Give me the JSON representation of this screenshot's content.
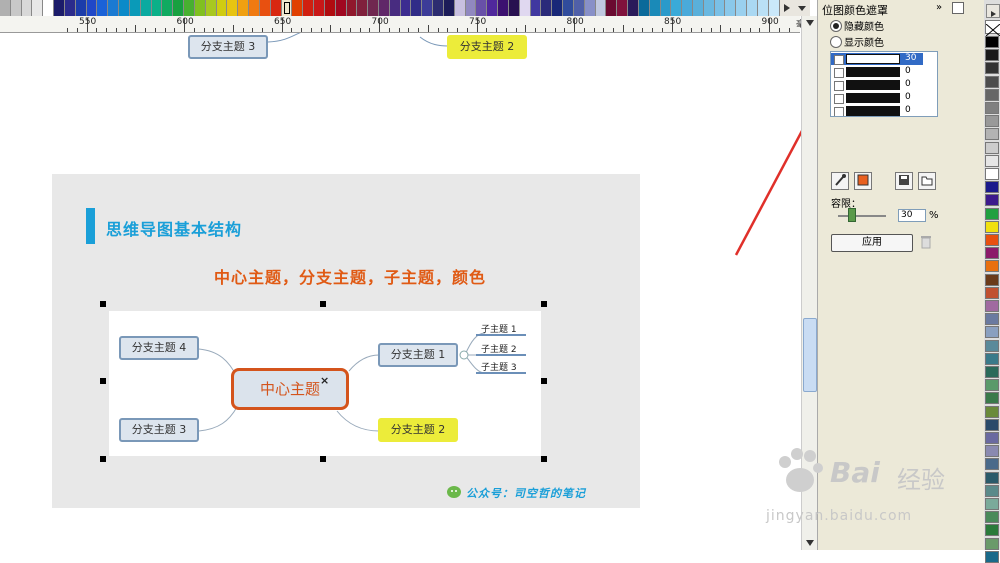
{
  "top_palette": {
    "colors": [
      "#b0b0b0",
      "#c8c8c8",
      "#d8d8d8",
      "#e8e8e8",
      "#ffffff",
      "#1c1c6a",
      "#2b2b8c",
      "#1c3caa",
      "#2048c8",
      "#1a62d8",
      "#1a7ad2",
      "#0a8ac8",
      "#0a9ab8",
      "#0aaaa0",
      "#0ab088",
      "#10aa60",
      "#18a040",
      "#48b030",
      "#80c020",
      "#a8c820",
      "#d0cc10",
      "#e8c410",
      "#f0a010",
      "#f07a10",
      "#e85010",
      "#d82810",
      "#f0e8d0",
      "#e04000",
      "#d02010",
      "#c81818",
      "#b00c10",
      "#a00820",
      "#90182c",
      "#80203c",
      "#702850",
      "#602868",
      "#482c80",
      "#3c2c90",
      "#302c88",
      "#3c3c98",
      "#2c2c70",
      "#1c1c58",
      "#c8c0e0",
      "#9088c0",
      "#6850a8",
      "#50289c",
      "#3c1070",
      "#281050",
      "#e0d8f0",
      "#4038a0",
      "#2a2a7a",
      "#182878",
      "#304c9c",
      "#5060a8",
      "#8890c8",
      "#c0c8e0",
      "#6a0a30",
      "#80123c",
      "#2a1a5a",
      "#0a6a9a",
      "#1a8ab8",
      "#2a9aca",
      "#3aaad8",
      "#4aaada",
      "#5ab0da",
      "#6ab8e0",
      "#7ac0e6",
      "#8ac8ea",
      "#9ad0ee",
      "#aad8f2",
      "#bae0f6",
      "#cae8fa"
    ],
    "selected_index": 26
  },
  "ruler": {
    "labels": [
      "550",
      "600",
      "650",
      "700",
      "750",
      "800",
      "850",
      "900"
    ],
    "unit": "毫米"
  },
  "canvas": {
    "top_node_left": "分支主题 3",
    "top_node_right": "分支主题 2",
    "slide": {
      "title": "思维导图基本结构",
      "subtitle": "中心主题，分支主题，子主题，颜色",
      "central": "中心主题",
      "branch1": "分支主题 1",
      "branch2": "分支主题 2",
      "branch3": "分支主题 3",
      "branch4": "分支主题 4",
      "sub1": "子主题 1",
      "sub2": "子主题 2",
      "sub3": "子主题 3",
      "footer": "公众号：司空哲的笔记"
    }
  },
  "docker": {
    "title": "位图颜色遮罩",
    "radio_hide": "隐藏颜色",
    "radio_show": "显示颜色",
    "list_rows": [
      {
        "checked": true,
        "value": "30"
      },
      {
        "checked": false,
        "value": "0"
      },
      {
        "checked": false,
        "value": "0"
      },
      {
        "checked": false,
        "value": "0"
      },
      {
        "checked": false,
        "value": "0"
      }
    ],
    "tolerance_label": "容限：",
    "tolerance_value": "30",
    "percent": "%",
    "apply": "应用"
  },
  "right_palette": {
    "colors": [
      "#000000",
      "#1a1a1a",
      "#333333",
      "#4d4d4d",
      "#666666",
      "#808080",
      "#999999",
      "#b3b3b3",
      "#cccccc",
      "#e6e6e6",
      "#ffffff",
      "#1a1a8c",
      "#3c1a8c",
      "#20a040",
      "#f0e010",
      "#e85010",
      "#8c1a6a",
      "#e87010",
      "#6a3a1a",
      "#c05030",
      "#a06aa0",
      "#6a7aa0",
      "#8aa0c0",
      "#5a8a9a",
      "#3a7a8a",
      "#2a6a5a",
      "#5a9a6a",
      "#3a7a4a",
      "#6a8a3a",
      "#2a4a6a",
      "#6a6aa0",
      "#8a8ab0",
      "#4a6a8a",
      "#2a5a6a",
      "#5a8a8a",
      "#7aaa9a",
      "#4a8a5a",
      "#2a7a3a",
      "#6a9a6a",
      "#1a6a8a"
    ]
  },
  "watermark": {
    "brand": "Bai",
    "brand_cn": "经验",
    "site": "jingyan.baidu.com"
  }
}
